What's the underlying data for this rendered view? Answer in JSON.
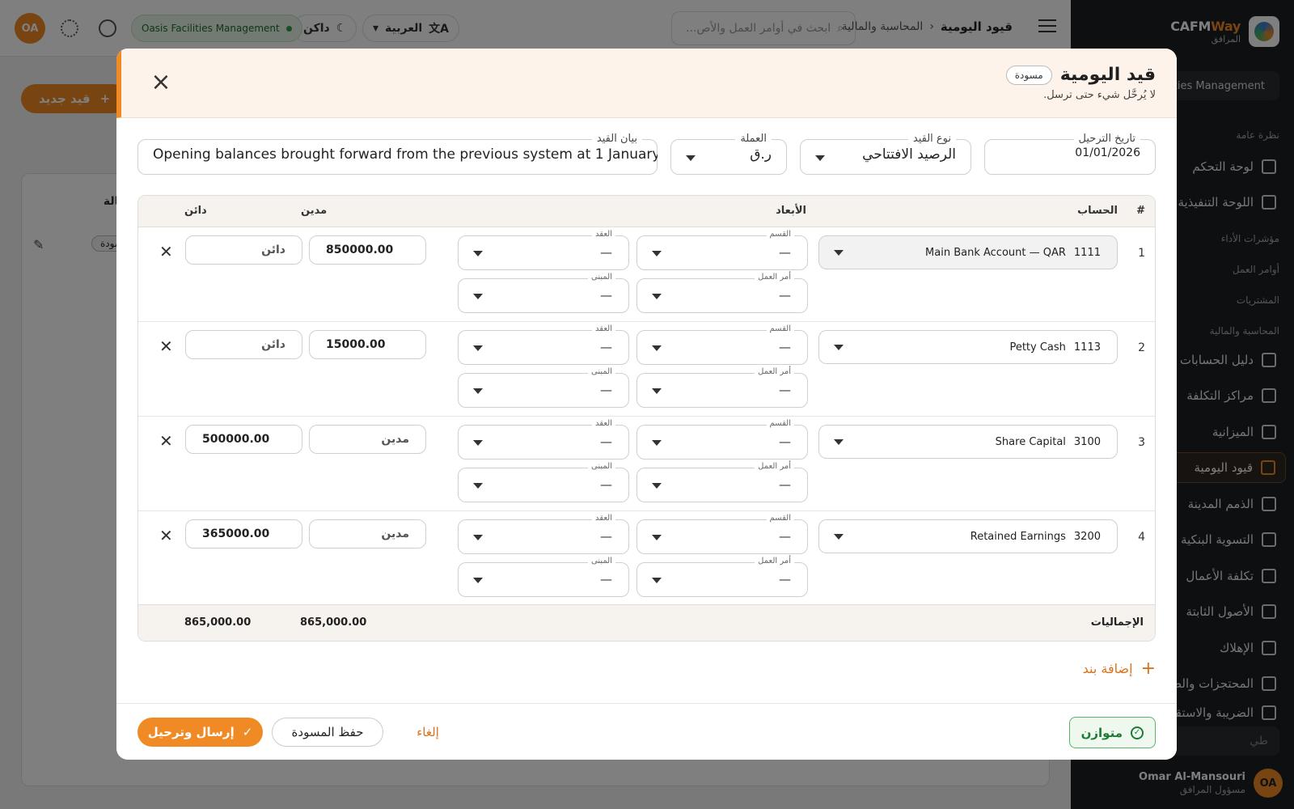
{
  "topbar": {
    "breadcrumb_parent": "المحاسبة والمالية",
    "breadcrumb_current": "قيود اليومية",
    "search_placeholder": "ابحث في أوامر العمل والأص...",
    "language": "العربية",
    "theme": "داكن",
    "organization": "Oasis Facilities Management",
    "avatar_initials": "OA"
  },
  "sidebar": {
    "brand_name_a": "CAFM",
    "brand_name_b": "Way",
    "brand_sub": "المرافق",
    "tenant": "Oasis Facilities Management",
    "groups": [
      "نظرة عامة",
      "مؤشرات الأداء",
      "أوامر العمل",
      "المشتريات",
      "المحاسبة والمالية"
    ],
    "items": [
      {
        "label": "لوحة التحكم",
        "icon": "dashboard-icon"
      },
      {
        "label": "اللوحة التنفيذية",
        "icon": "bar-chart-icon"
      },
      {
        "label": "دليل الحسابات",
        "icon": "hierarchy-icon"
      },
      {
        "label": "مراكز التكلفة",
        "icon": "network-icon"
      },
      {
        "label": "الميزانية",
        "icon": "wallet-icon"
      },
      {
        "label": "قيود اليومية",
        "icon": "journal-edit-icon"
      },
      {
        "label": "الذمم المدينة",
        "icon": "dollar-file-icon"
      },
      {
        "label": "التسوية البنكية",
        "icon": "bank-icon"
      },
      {
        "label": "تكلفة الأعمال",
        "icon": "calculator-icon"
      },
      {
        "label": "الأصول الثابتة",
        "icon": "building-icon"
      },
      {
        "label": "الإهلاك",
        "icon": "trend-down-icon"
      },
      {
        "label": "المحتجزات والضما",
        "icon": "lock-file-icon"
      },
      {
        "label": "الضريبة والاستقطاع",
        "icon": "tax-icon"
      }
    ],
    "collapse_label": "طي",
    "user_name": "Omar Al-Mansouri",
    "user_role": "مسؤول المرافق",
    "user_initials": "OA"
  },
  "background": {
    "new_entry_label": "قيد جديد",
    "status_header": "الحالة",
    "draft_badge": "مسودة"
  },
  "modal": {
    "title": "قيد اليومية",
    "status": "مسودة",
    "subtitle": "لا يُرحَّل شيء حتى ترسل.",
    "fields": {
      "posting_date_label": "تاريخ الترحيل",
      "posting_date": "01/01/2026",
      "entry_type_label": "نوع القيد",
      "entry_type": "الرصيد الافتتاحي",
      "currency_label": "العملة",
      "currency": "ر.ق",
      "memo_label": "بيان القيد",
      "memo": "Opening balances brought forward from the previous system at 1 January 2026"
    },
    "columns": {
      "num": "#",
      "account": "الحساب",
      "dimensions": "الأبعاد",
      "debit": "مدين",
      "credit": "دائن"
    },
    "dim_labels": {
      "division": "القسم",
      "contract": "العقد",
      "work_order": "أمر العمل",
      "building": "المبنى"
    },
    "dim_empty": "—",
    "lines": [
      {
        "num": "1",
        "code": "1111",
        "account": "Main Bank Account — QAR",
        "debit": "850000.00",
        "credit": "دائن"
      },
      {
        "num": "2",
        "code": "1113",
        "account": "Petty Cash",
        "debit": "15000.00",
        "credit": "دائن"
      },
      {
        "num": "3",
        "code": "3100",
        "account": "Share Capital",
        "debit": "مدين",
        "credit": "500000.00"
      },
      {
        "num": "4",
        "code": "3200",
        "account": "Retained Earnings",
        "debit": "مدين",
        "credit": "365000.00"
      }
    ],
    "totals_label": "الإجماليات",
    "total_debit": "865,000.00",
    "total_credit": "865,000.00",
    "add_line": "إضافة بند",
    "balanced": "متوازن",
    "cancel": "إلغاء",
    "save_draft": "حفظ المسودة",
    "submit_post": "إرسال وترحيل"
  },
  "colors": {
    "accent": "#f08a24",
    "success": "#1f7a33",
    "sidebar_bg": "#1d1f22"
  }
}
